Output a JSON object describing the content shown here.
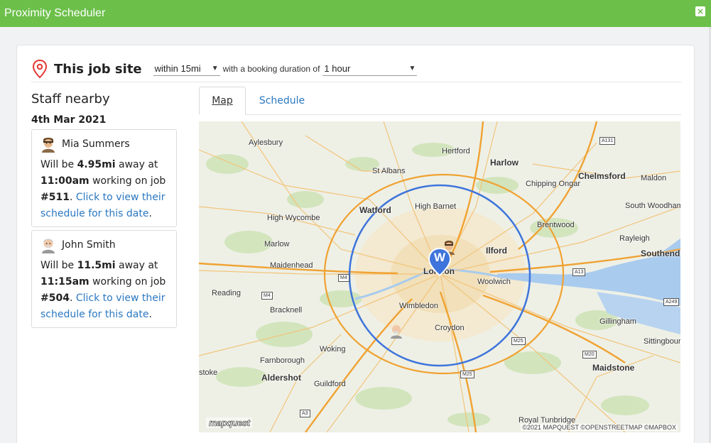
{
  "window": {
    "title": "Proximity Scheduler",
    "close_glyph": "×"
  },
  "header": {
    "title": "This job site",
    "radius_select": "within 15mi",
    "between_text": "with a booking duration of",
    "duration_select": "1 hour"
  },
  "sidebar": {
    "heading": "Staff nearby",
    "date": "4th Mar 2021",
    "staff": [
      {
        "name": "Mia Summers",
        "will_be": "Will be",
        "distance": "4.95mi",
        "away_at": "away at",
        "time": "11:00am",
        "working_on": "working on job",
        "job": "#511",
        "link": "Click to view their schedule for this date"
      },
      {
        "name": "John Smith",
        "will_be": "Will be",
        "distance": "11.5mi",
        "away_at": "away at",
        "time": "11:15am",
        "working_on": "working on job",
        "job": "#504",
        "link": "Click to view their schedule for this date"
      }
    ]
  },
  "tabs": {
    "map": "Map",
    "schedule": "Schedule"
  },
  "map": {
    "marker_letter": "W",
    "logo": "mapquest",
    "copyright": "©2021 MAPQUEST ©OPENSTREETMAP ©MAPBOX",
    "places": {
      "aylesbury": "Aylesbury",
      "hertford": "Hertford",
      "harlow": "Harlow",
      "st_albans": "St Albans",
      "chelmsford": "Chelmsford",
      "maldon": "Maldon",
      "chipping_ongar": "Chipping Ongar",
      "watford": "Watford",
      "high_barnet": "High Barnet",
      "south_woodham_ferrers": "South Woodham Ferrers",
      "high_wycombe": "High Wycombe",
      "brentwood": "Brentwood",
      "rayleigh": "Rayleigh",
      "marlow": "Marlow",
      "ilford": "Ilford",
      "southend_on_sea": "Southend-on-Sea",
      "maidenhead": "Maidenhead",
      "london": "London",
      "woolwich": "Woolwich",
      "reading": "Reading",
      "wimbledon": "Wimbledon",
      "bracknell": "Bracknell",
      "croydon": "Croydon",
      "gillingham": "Gillingham",
      "woking": "Woking",
      "sittingbourne": "Sittingbour",
      "farnborough": "Farnborough",
      "aldershot": "Aldershot",
      "stoke": "stoke",
      "guildford": "Guildford",
      "maidstone": "Maidstone",
      "royal_tunbridge": "Royal Tunbridge"
    },
    "roads": {
      "a131": "A131",
      "m4_west": "M4",
      "m4": "M4",
      "a13": "A13",
      "a249": "A249",
      "m25_east": "M25",
      "m20": "M20",
      "m25_south": "M25",
      "a3": "A3"
    }
  },
  "colors": {
    "title_bar": "#6cc04a",
    "link": "#2a78c2",
    "radius_circle": "#3e74db",
    "pin_red": "#e53935",
    "road_orange": "#f0a232",
    "water": "#a9cbee"
  },
  "icons": {
    "job_site": "map-pin-icon",
    "staff_mia": "person-avatar-icon",
    "staff_john": "person-avatar-icon"
  }
}
